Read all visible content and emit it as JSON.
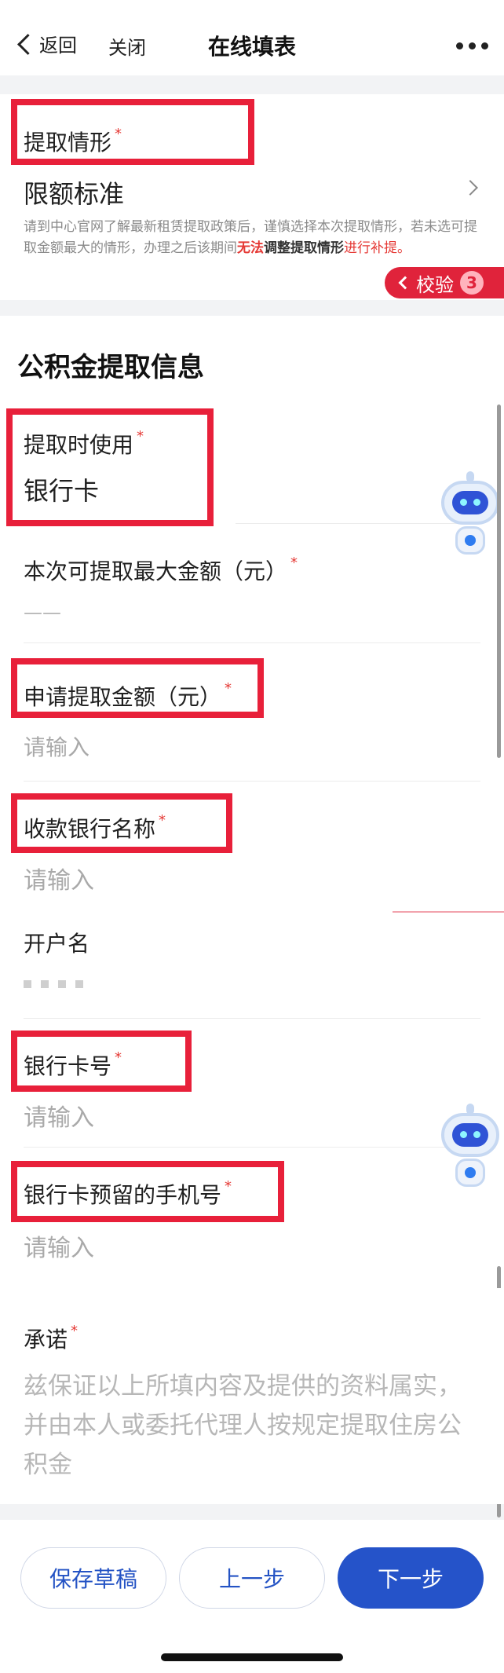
{
  "nav": {
    "back_label": "返回",
    "close_label": "关闭",
    "title": "在线填表"
  },
  "withdraw_situation": {
    "label": "提取情形",
    "required_mark": "*",
    "value": "限额标准",
    "note_part1": "请到中心官网了解最新租赁提取政策后，谨慎选择本次提取情形，若未选可提取金额最大的情形，办理之后该期间",
    "note_red": "无法",
    "note_dark": "调整提取情形",
    "note_end": "进行补提。"
  },
  "verify": {
    "label": "校验",
    "count": "3"
  },
  "section_title": "公积金提取信息",
  "fields": {
    "payment_method": {
      "label": "提取时使用",
      "required_mark": "*",
      "value": "银行卡"
    },
    "max_amount": {
      "label": "本次可提取最大金额（元）",
      "required_mark": "*",
      "value": "——"
    },
    "apply_amount": {
      "label": "申请提取金额（元）",
      "required_mark": "*",
      "placeholder": "请输入"
    },
    "bank_name": {
      "label": "收款银行名称",
      "required_mark": "*",
      "placeholder": "请输入"
    },
    "account_holder": {
      "label": "开户名"
    },
    "card_number": {
      "label": "银行卡号",
      "required_mark": "*",
      "placeholder": "请输入"
    },
    "phone": {
      "label": "银行卡预留的手机号",
      "required_mark": "*",
      "placeholder": "请输入"
    }
  },
  "pledge": {
    "label": "承诺",
    "required_mark": "*",
    "text": "兹保证以上所填内容及提供的资料属实，并由本人或委托代理人按规定提取住房公积金"
  },
  "buttons": {
    "save": "保存草稿",
    "prev": "上一步",
    "next": "下一步"
  },
  "colors": {
    "accent": "#2553c9",
    "highlight": "#e8203a",
    "placeholder": "#a9a9a9"
  }
}
